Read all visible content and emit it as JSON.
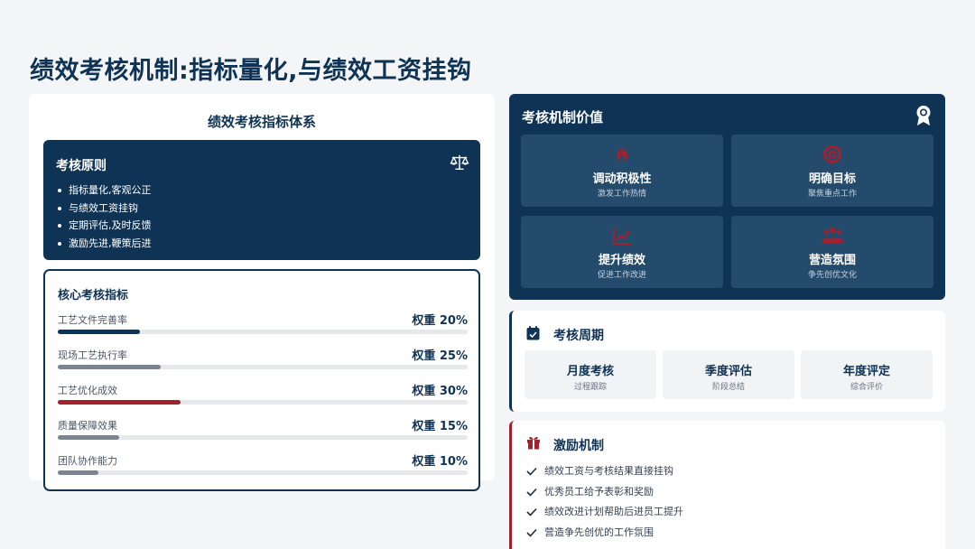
{
  "page": {
    "title": "绩效考核机制:指标量化,与绩效工资挂钩"
  },
  "left_panel": {
    "title": "绩效考核指标体系",
    "principles": {
      "title": "考核原则",
      "icon": "scale-icon",
      "items": [
        "指标量化,客观公正",
        "与绩效工资挂钩",
        "定期评估,及时反馈",
        "激励先进,鞭策后进"
      ]
    },
    "indicators": {
      "title": "核心考核指标",
      "items": [
        {
          "name": "工艺文件完善率",
          "weight_label": "权重 20%",
          "fill_fraction": 0.2,
          "color": "#0f3354"
        },
        {
          "name": "现场工艺执行率",
          "weight_label": "权重 25%",
          "fill_fraction": 0.25,
          "color": "#7a8591"
        },
        {
          "name": "工艺优化成效",
          "weight_label": "权重 30%",
          "fill_fraction": 0.3,
          "color": "#a3202e"
        },
        {
          "name": "质量保障效果",
          "weight_label": "权重 15%",
          "fill_fraction": 0.15,
          "color": "#7a8591"
        },
        {
          "name": "团队协作能力",
          "weight_label": "权重 10%",
          "fill_fraction": 0.1,
          "color": "#7a8591"
        }
      ]
    }
  },
  "value_panel": {
    "title": "考核机制价值",
    "icon": "award-icon",
    "tiles": [
      {
        "title": "调动积极性",
        "subtitle": "激发工作热情",
        "icon": "fire-icon"
      },
      {
        "title": "明确目标",
        "subtitle": "聚焦重点工作",
        "icon": "target-icon"
      },
      {
        "title": "提升绩效",
        "subtitle": "促进工作改进",
        "icon": "chart-up-icon"
      },
      {
        "title": "营造氛围",
        "subtitle": "争先创优文化",
        "icon": "group-icon"
      }
    ]
  },
  "cycle_panel": {
    "title": "考核周期",
    "icon": "calendar-check-icon",
    "items": [
      {
        "title": "月度考核",
        "subtitle": "过程跟踪"
      },
      {
        "title": "季度评估",
        "subtitle": "阶段总结"
      },
      {
        "title": "年度评定",
        "subtitle": "综合评价"
      }
    ]
  },
  "incentive_panel": {
    "title": "激励机制",
    "icon": "gift-icon",
    "items": [
      "绩效工资与考核结果直接挂钩",
      "优秀员工给予表彰和奖励",
      "绩效改进计划帮助后进员工提升",
      "营造争先创优的工作氛围"
    ]
  },
  "colors": {
    "navy": "#0f3354",
    "tile": "#244a6c",
    "accent_red": "#a3202e",
    "gray_bar": "#7a8591",
    "background": "#f4f5f7"
  }
}
